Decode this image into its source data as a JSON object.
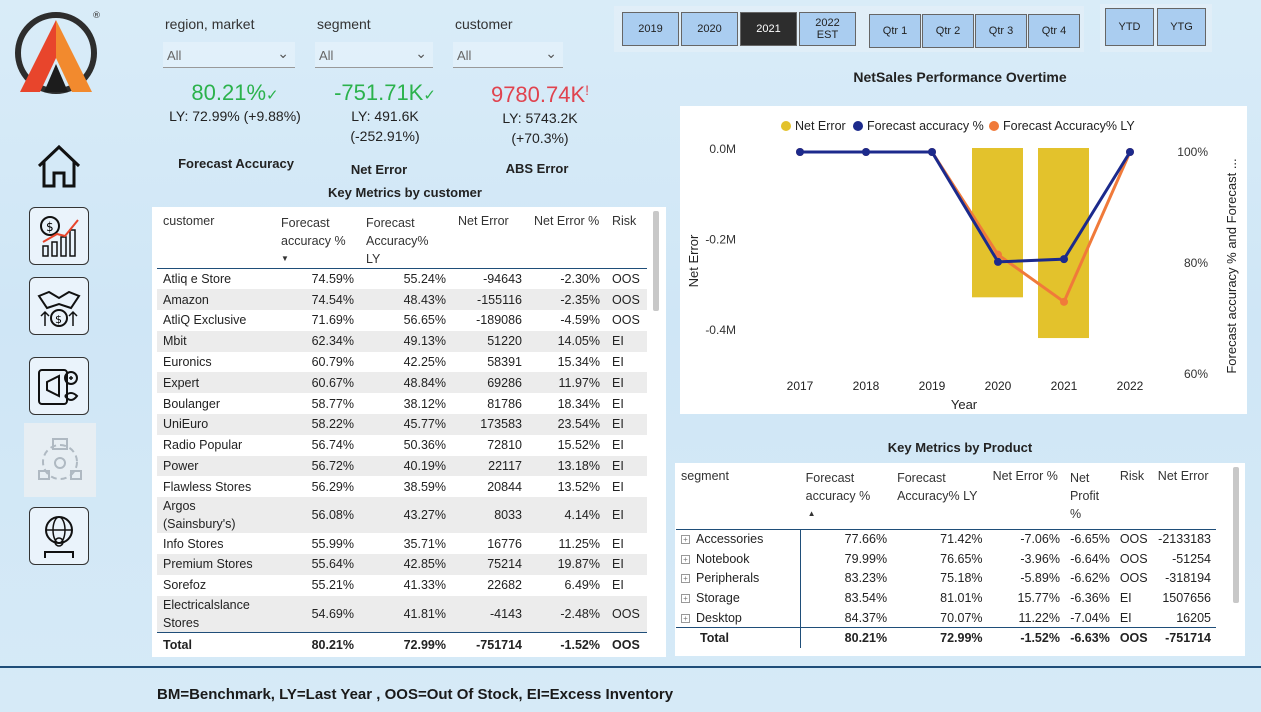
{
  "slicers": [
    {
      "label": "region, market",
      "value": "All"
    },
    {
      "label": "segment",
      "value": "All"
    },
    {
      "label": "customer",
      "value": "All"
    }
  ],
  "year_buttons": [
    {
      "label": "2019",
      "selected": false
    },
    {
      "label": "2020",
      "selected": false
    },
    {
      "label": "2021",
      "selected": true
    },
    {
      "label": "2022 EST",
      "selected": false
    }
  ],
  "quarter_buttons": [
    "Qtr 1",
    "Qtr 2",
    "Qtr 3",
    "Qtr 4"
  ],
  "ytd_buttons": [
    "YTD",
    "YTG"
  ],
  "kpis": {
    "forecast_accuracy": {
      "value": "80.21%",
      "mark": "✓",
      "ly": "LY: 72.99% (+9.88%)",
      "title": "Forecast Accuracy",
      "color": "#2bb24c"
    },
    "net_error": {
      "value": "-751.71K",
      "mark": "✓",
      "ly": "LY: 491.6K",
      "change": "(-252.91%)",
      "title": "Net Error",
      "color": "#2bb24c"
    },
    "abs_error": {
      "value": "9780.74K",
      "mark": "!",
      "ly": "LY: 5743.2K",
      "change": "(+70.3%)",
      "title": "ABS Error",
      "color": "#e0434f"
    }
  },
  "customer_table": {
    "title": "Key Metrics by customer",
    "headers": [
      "customer",
      "Forecast accuracy %",
      "Forecast Accuracy% LY",
      "Net Error",
      "Net Error %",
      "Risk"
    ],
    "rows": [
      [
        "Atliq e Store",
        "74.59%",
        "55.24%",
        "-94643",
        "-2.30%",
        "OOS"
      ],
      [
        "Amazon",
        "74.54%",
        "48.43%",
        "-155116",
        "-2.35%",
        "OOS"
      ],
      [
        "AtliQ Exclusive",
        "71.69%",
        "56.65%",
        "-189086",
        "-4.59%",
        "OOS"
      ],
      [
        "Mbit",
        "62.34%",
        "49.13%",
        "51220",
        "14.05%",
        "EI"
      ],
      [
        "Euronics",
        "60.79%",
        "42.25%",
        "58391",
        "15.34%",
        "EI"
      ],
      [
        "Expert",
        "60.67%",
        "48.84%",
        "69286",
        "11.97%",
        "EI"
      ],
      [
        "Boulanger",
        "58.77%",
        "38.12%",
        "81786",
        "18.34%",
        "EI"
      ],
      [
        "UniEuro",
        "58.22%",
        "45.77%",
        "173583",
        "23.54%",
        "EI"
      ],
      [
        "Radio Popular",
        "56.74%",
        "50.36%",
        "72810",
        "15.52%",
        "EI"
      ],
      [
        "Power",
        "56.72%",
        "40.19%",
        "22117",
        "13.18%",
        "EI"
      ],
      [
        "Flawless Stores",
        "56.29%",
        "38.59%",
        "20844",
        "13.52%",
        "EI"
      ],
      [
        "Argos (Sainsbury's)",
        "56.08%",
        "43.27%",
        "8033",
        "4.14%",
        "EI"
      ],
      [
        "Info Stores",
        "55.99%",
        "35.71%",
        "16776",
        "11.25%",
        "EI"
      ],
      [
        "Premium Stores",
        "55.64%",
        "42.85%",
        "75214",
        "19.87%",
        "EI"
      ],
      [
        "Sorefoz",
        "55.21%",
        "41.33%",
        "22682",
        "6.49%",
        "EI"
      ],
      [
        "Electricalslance Stores",
        "54.69%",
        "41.81%",
        "-4143",
        "-2.48%",
        "OOS"
      ]
    ],
    "total": [
      "Total",
      "80.21%",
      "72.99%",
      "-751714",
      "-1.52%",
      "OOS"
    ]
  },
  "product_table": {
    "title": "Key Metrics by Product",
    "headers": [
      "segment",
      "Forecast accuracy %",
      "Forecast Accuracy% LY",
      "Net Error %",
      "Net Profit %",
      "Risk",
      "Net Error"
    ],
    "rows": [
      [
        "Accessories",
        "77.66%",
        "71.42%",
        "-7.06%",
        "-6.65%",
        "OOS",
        "-2133183"
      ],
      [
        "Notebook",
        "79.99%",
        "76.65%",
        "-3.96%",
        "-6.64%",
        "OOS",
        "-51254"
      ],
      [
        "Peripherals",
        "83.23%",
        "75.18%",
        "-5.89%",
        "-6.62%",
        "OOS",
        "-318194"
      ],
      [
        "Storage",
        "83.54%",
        "81.01%",
        "15.77%",
        "-6.36%",
        "EI",
        "1507656"
      ],
      [
        "Desktop",
        "84.37%",
        "70.07%",
        "11.22%",
        "-7.04%",
        "EI",
        "16205"
      ]
    ],
    "total": [
      "Total",
      "80.21%",
      "72.99%",
      "-1.52%",
      "-6.63%",
      "OOS",
      "-751714"
    ]
  },
  "chart_data": {
    "type": "bar",
    "title": "NetSales Performance Overtime",
    "xlabel": "Year",
    "ylabel": "Net Error",
    "y2label": "Forecast accuracy % and Forecast ...",
    "categories": [
      "2017",
      "2018",
      "2019",
      "2020",
      "2021",
      "2022"
    ],
    "ylim": [
      -0.45,
      0.0
    ],
    "yticks": [
      "0.0M",
      "-0.2M",
      "-0.4M"
    ],
    "y2lim": [
      60,
      100
    ],
    "y2ticks": [
      "100%",
      "80%",
      "60%"
    ],
    "legend_position": "top",
    "series": [
      {
        "name": "Net Error",
        "kind": "bar",
        "color": "#e3c22c",
        "values": [
          0,
          0,
          0,
          -0.33,
          -0.42,
          0
        ]
      },
      {
        "name": "Forecast accuracy %",
        "kind": "line",
        "color": "#1c2a8c",
        "values": [
          100,
          100,
          100,
          80.2,
          80.7,
          100
        ]
      },
      {
        "name": "Forecast Accuracy% LY",
        "kind": "line",
        "color": "#f07a3a",
        "values": [
          100,
          100,
          100,
          81.5,
          73.0,
          100
        ]
      }
    ]
  },
  "footer": "BM=Benchmark, LY=Last Year , OOS=Out Of Stock, EI=Excess Inventory"
}
